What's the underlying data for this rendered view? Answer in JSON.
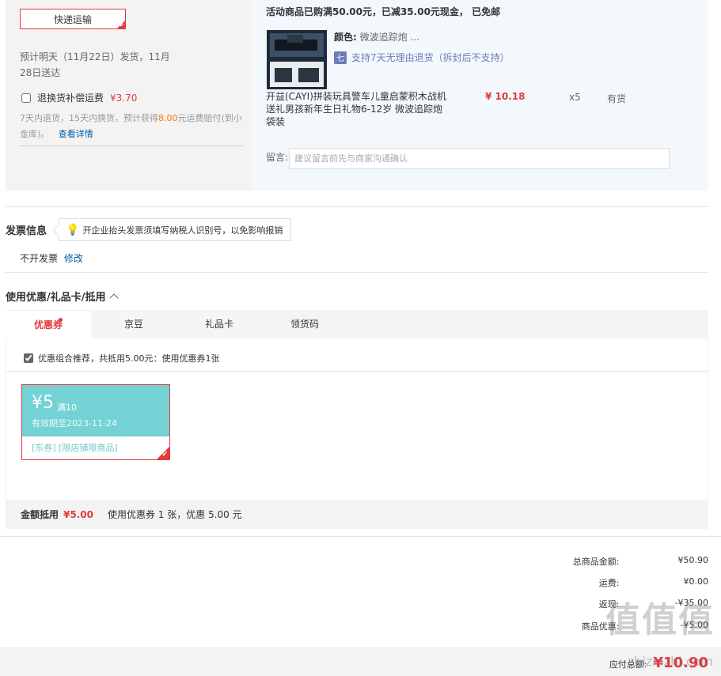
{
  "shipping": {
    "method_button": "快递运输",
    "eta": "预计明天（11月22日）发货，11月28日送达",
    "return_insurance_label": "退换货补偿运费",
    "return_insurance_price": "¥3.70",
    "return_note_prefix": "7天内退货，15天内换货，预计获得",
    "return_note_amount": "8.00",
    "return_note_suffix": "元运费赔付(到小金库)。",
    "details_link": "查看详情"
  },
  "order_item": {
    "promo": "活动商品已购满50.00元，已减35.00元现金， 已免邮",
    "color_label": "颜色:",
    "color_value": "微波追踪炮 ...",
    "return_badge_icon": "七",
    "return_policy": "支持7天无理由退货（拆封后不支持）",
    "name": "开益(CAYI)拼装玩具警车儿童启蒙积木战机送礼男孩新年生日礼物6-12岁 微波追踪炮 袋装",
    "price": "¥ 10.18",
    "quantity": "x5",
    "stock": "有货",
    "message_label": "留言:",
    "message_placeholder": "建议留言前先与商家沟通确认"
  },
  "invoice": {
    "title": "发票信息",
    "tip": "开企业抬头发票须填写纳税人识别号，以免影响报销",
    "status": "不开发票",
    "edit_link": "修改"
  },
  "coupons": {
    "title": "使用优惠/礼品卡/抵用",
    "tabs": [
      {
        "label": "优惠券"
      },
      {
        "label": "京豆"
      },
      {
        "label": "礼品卡"
      },
      {
        "label": "领货码"
      }
    ],
    "combo_text": "优惠组合推荐，共抵用5.00元：使用优惠券1张",
    "coupon_card": {
      "amount": "¥5",
      "condition": "满10",
      "expiry": "有效期至2023-11-24",
      "tags": "[东券] [限店铺限商品]"
    },
    "summary_label": "金额抵用",
    "summary_value": "¥5.00",
    "summary_desc": "使用优惠券 1 张，优惠 5.00 元"
  },
  "totals": {
    "rows": [
      {
        "label": "总商品金额:",
        "value": "¥50.90"
      },
      {
        "label": "运费:",
        "value": "¥0.00"
      },
      {
        "label": "返现:",
        "value": "-¥35.00"
      },
      {
        "label": "商品优惠:",
        "value": "-¥5.00"
      }
    ],
    "pay_label": "应付总额:",
    "pay_value": "¥10.90"
  },
  "watermark": {
    "mark": "值值值",
    "url": "zhizhizhi.com"
  },
  "colors": {
    "accent": "#e4393c",
    "coupon_teal": "#74d2d4",
    "link": "#005ea7"
  }
}
